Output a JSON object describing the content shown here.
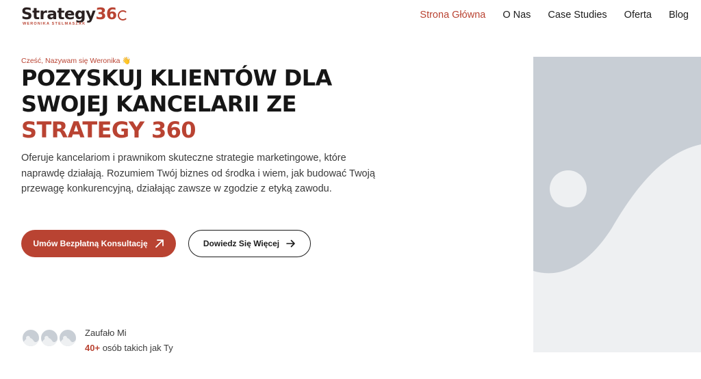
{
  "header": {
    "logo_text": "Strategy",
    "logo_accent": "36",
    "logo_sub": "WERONIKA STELMASZAK",
    "nav": [
      {
        "label": "Strona Główna",
        "active": true
      },
      {
        "label": "O Nas",
        "active": false
      },
      {
        "label": "Case Studies",
        "active": false
      },
      {
        "label": "Oferta",
        "active": false
      },
      {
        "label": "Blog",
        "active": false
      }
    ]
  },
  "hero": {
    "greeting": "Cześć, Nazywam się Weronika 👋",
    "headline_line1": "POZYSKUJ KLIENTÓW DLA",
    "headline_line2": "SWOJEJ KANCELARII ZE",
    "headline_line3": "STRATEGY 360",
    "lead": "Oferuje kancelariom i prawnikom skuteczne strategie marketingowe, które naprawdę działają. Rozumiem Twój biznes od środka i wiem, jak budować Twoją przewagę konkurencyjną, działając zawsze w zgodzie z etyką zawodu.",
    "cta_primary": "Umów Bezpłatną Konsultację",
    "cta_secondary": "Dowiedz Się Więcej"
  },
  "trust": {
    "title": "Zaufało Mi",
    "count": "40+",
    "subtitle": "osób takich jak Ty"
  },
  "colors": {
    "accent": "#b94332",
    "text": "#161616",
    "placeholder": "#c8ced5"
  }
}
